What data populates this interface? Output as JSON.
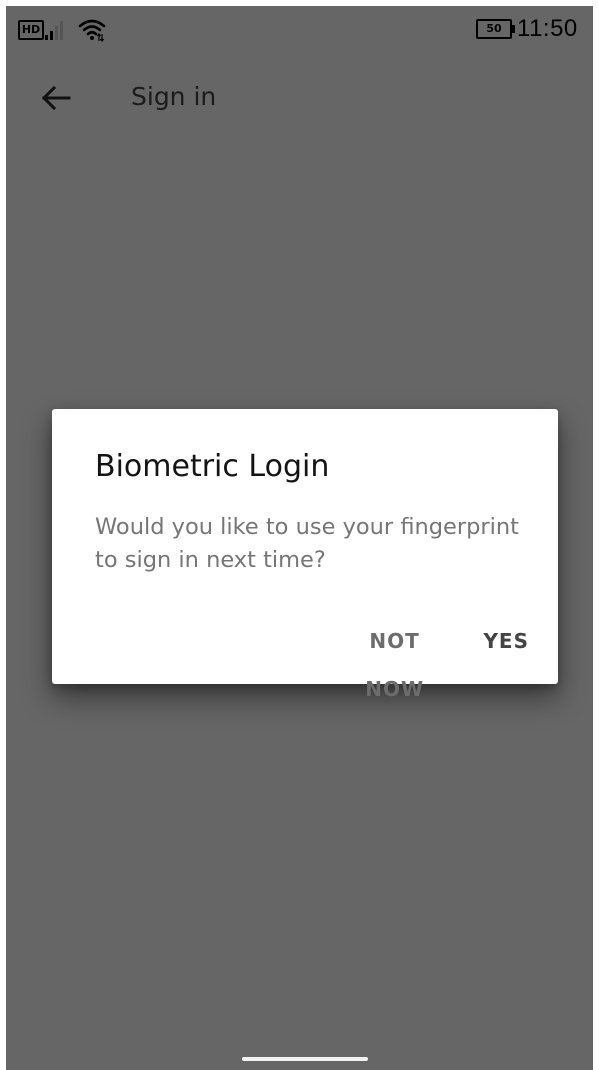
{
  "status_bar": {
    "network_badge": "HD",
    "battery_level": "50",
    "time": "11:50",
    "icons": [
      "signal-icon",
      "wifi-icon",
      "battery-icon"
    ]
  },
  "toolbar": {
    "back_icon": "arrow-left-icon",
    "title": "Sign in"
  },
  "dialog": {
    "title": "Biometric Login",
    "message": "Would you like to use your fingerprint to sign in next time?",
    "actions": {
      "negative_label": "NOT NOW",
      "positive_label": "YES"
    }
  },
  "colors": {
    "scrim": "#666666",
    "dialog_bg": "#ffffff",
    "title_text": "#141414",
    "message_text": "#767676",
    "nav_handle": "#f2f2f2"
  }
}
